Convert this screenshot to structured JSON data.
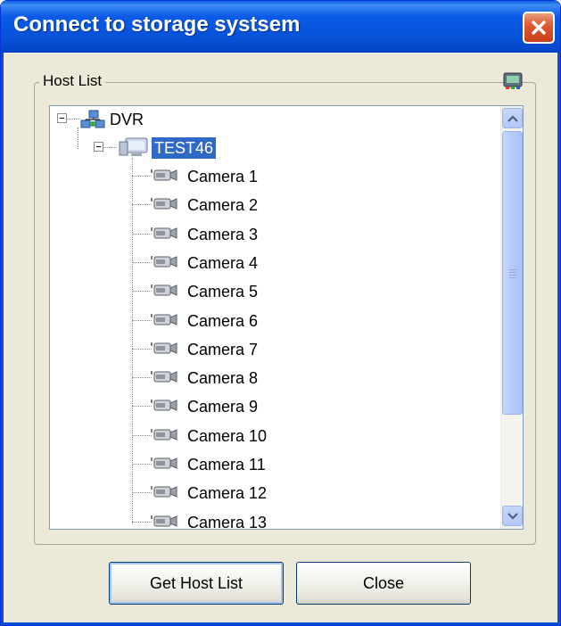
{
  "window": {
    "title": "Connect to storage systsem",
    "close_icon": "close-x-icon"
  },
  "host_list": {
    "label": "Host List",
    "options_icon": "network-settings-icon",
    "tree": {
      "root": {
        "label": "DVR",
        "icon": "network-group-icon",
        "expanded": true
      },
      "host": {
        "label": "TEST46",
        "icon": "monitor-icon",
        "expanded": true,
        "selected": true
      },
      "cameras": [
        "Camera 1",
        "Camera 2",
        "Camera 3",
        "Camera 4",
        "Camera 5",
        "Camera 6",
        "Camera 7",
        "Camera 8",
        "Camera 9",
        "Camera 10",
        "Camera 11",
        "Camera 12",
        "Camera 13"
      ],
      "camera_icon": "camera-icon"
    }
  },
  "buttons": {
    "get_host_list": "Get Host List",
    "close": "Close"
  },
  "colors": {
    "title_bar": "#0a5be8",
    "selection": "#316ac5",
    "dialog_bg": "#ece9d8"
  }
}
